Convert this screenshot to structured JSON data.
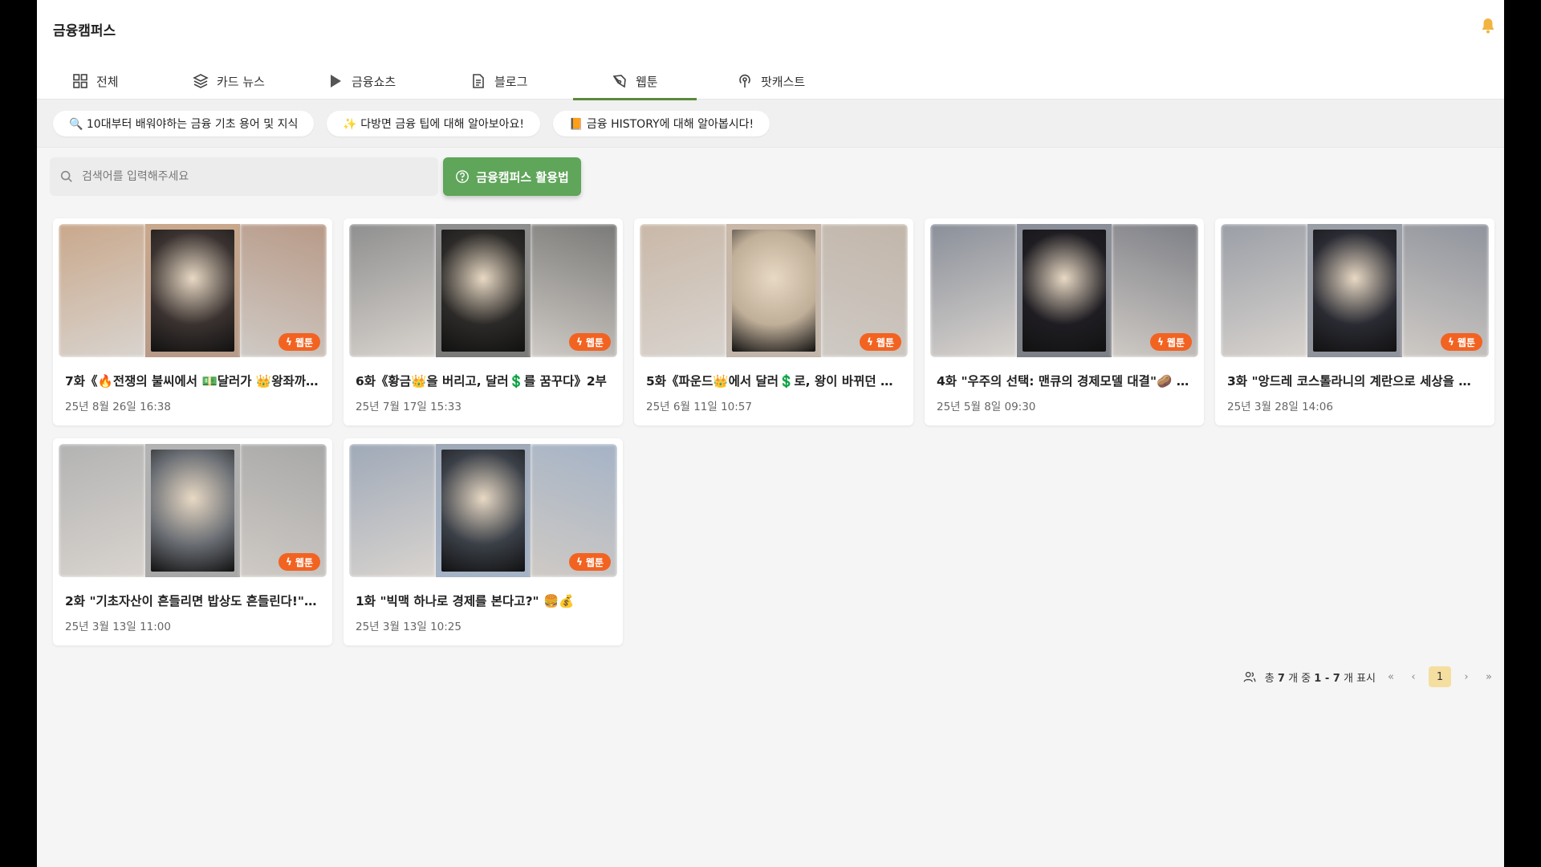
{
  "app": {
    "title": "금융캠퍼스"
  },
  "tabs": [
    {
      "label": "전체",
      "icon": "grid-icon"
    },
    {
      "label": "카드 뉴스",
      "icon": "layers-icon"
    },
    {
      "label": "금융쇼츠",
      "icon": "play-icon"
    },
    {
      "label": "블로그",
      "icon": "document-icon"
    },
    {
      "label": "웹툰",
      "icon": "pen-icon",
      "active": true
    },
    {
      "label": "팟캐스트",
      "icon": "podcast-icon"
    }
  ],
  "chips": [
    "🔍 10대부터 배워야하는 금융 기초 용어 및 지식",
    "✨ 다방면 금융 팁에 대해 알아보아요!",
    "📙 금융 HISTORY에 대해 알아봅시다!"
  ],
  "search": {
    "placeholder": "검색어를 입력해주세요",
    "value": ""
  },
  "guide_button": {
    "label": "금융캠퍼스 활용법"
  },
  "badge_label": "웹툰",
  "cards": [
    {
      "title": "7화《🔥전쟁의 불씨에서 💵달러가 👑왕좌까지...",
      "date": "25년 8월 26일 16:38",
      "colors": [
        "#c9a88c",
        "#3a3230",
        "#b89a88"
      ]
    },
    {
      "title": "6화《황금👑을 버리고, 달러💲를 꿈꾸다》2부",
      "date": "25년 7월 17일 15:33",
      "colors": [
        "#8f8f8f",
        "#2c2a28",
        "#7a7a78"
      ]
    },
    {
      "title": "5화《파운드👑에서 달러💲로, 왕이 바뀌던 날...",
      "date": "25년 6월 11일 10:57",
      "colors": [
        "#c9b8a8",
        "#bfae98",
        "#c2b6aa"
      ]
    },
    {
      "title": "4화 \"우주의 선택: 맨큐의 경제모델 대결\"🥔 v...",
      "date": "25년 5월 8일 09:30",
      "colors": [
        "#8a8f99",
        "#1f1d22",
        "#7d7f86"
      ]
    },
    {
      "title": "3화 \"앙드레 코스톨라니의 계란으로 세상을 읽...",
      "date": "25년 3월 28일 14:06",
      "colors": [
        "#9a9ea6",
        "#2a2b33",
        "#8f939c"
      ]
    },
    {
      "title": "2화 \"기초자산이 흔들리면 밥상도 흔들린다!\" ...",
      "date": "25년 3월 13일 11:00",
      "colors": [
        "#b3b3b3",
        "#6a6e74",
        "#a8a8a8"
      ]
    },
    {
      "title": "1화 \"빅맥 하나로 경제를 본다고?\" 🍔💰",
      "date": "25년 3월 13일 10:25",
      "colors": [
        "#9fa9b8",
        "#3b4048",
        "#a5b3c6"
      ]
    }
  ],
  "pagination": {
    "summary_prefix": "총",
    "total": "7",
    "summary_mid": "개 중",
    "range": "1 - 7",
    "summary_suffix": "개 표시",
    "current_page": "1"
  },
  "colors": {
    "accent_green": "#5fa55a",
    "badge_orange": "#f26322",
    "tab_underline": "#5a8a3c",
    "page_highlight": "#f5dfa0"
  }
}
